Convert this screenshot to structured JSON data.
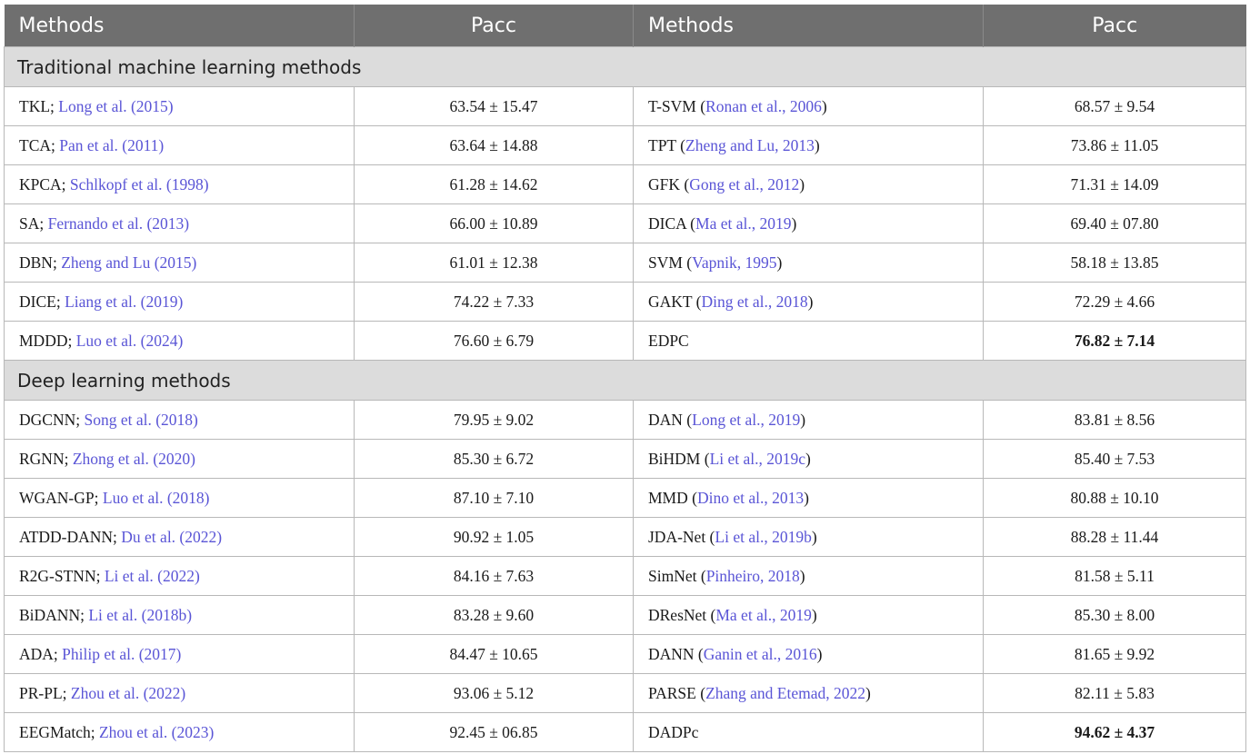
{
  "headers": [
    "Methods",
    "Pacc",
    "Methods",
    "Pacc"
  ],
  "sections": [
    {
      "title": "Traditional machine learning methods",
      "rows": [
        {
          "m1": "TKL; ",
          "r1": "Long et al. (2015)",
          "t1": "",
          "v1": "63.54 ± 15.47",
          "m2": "T-SVM (",
          "r2": "Ronan et al., 2006",
          "t2": ")",
          "v2": "68.57 ± 9.54",
          "b2": false
        },
        {
          "m1": "TCA; ",
          "r1": "Pan et al. (2011)",
          "t1": "",
          "v1": "63.64 ± 14.88",
          "m2": "TPT (",
          "r2": "Zheng and Lu, 2013",
          "t2": ")",
          "v2": "73.86 ± 11.05",
          "b2": false
        },
        {
          "m1": "KPCA; ",
          "r1": "Schlkopf et al. (1998)",
          "t1": "",
          "v1": "61.28 ± 14.62",
          "m2": "GFK (",
          "r2": "Gong et al., 2012",
          "t2": ")",
          "v2": "71.31 ± 14.09",
          "b2": false
        },
        {
          "m1": "SA; ",
          "r1": "Fernando et al. (2013)",
          "t1": "",
          "v1": "66.00 ± 10.89",
          "m2": "DICA (",
          "r2": "Ma et al., 2019",
          "t2": ")",
          "v2": "69.40 ± 07.80",
          "b2": false
        },
        {
          "m1": "DBN; ",
          "r1": "Zheng and Lu (2015)",
          "t1": "",
          "v1": "61.01 ± 12.38",
          "m2": "SVM (",
          "r2": "Vapnik, 1995",
          "t2": ")",
          "v2": "58.18 ± 13.85",
          "b2": false
        },
        {
          "m1": "DICE; ",
          "r1": "Liang et al. (2019)",
          "t1": "",
          "v1": "74.22 ± 7.33",
          "m2": "GAKT (",
          "r2": "Ding et al., 2018",
          "t2": ")",
          "v2": "72.29 ± 4.66",
          "b2": false
        },
        {
          "m1": "MDDD; ",
          "r1": "Luo et al. (2024)",
          "t1": "",
          "v1": "76.60 ± 6.79",
          "m2": "EDPC",
          "r2": "",
          "t2": "",
          "v2": "76.82 ± 7.14",
          "b2": true
        }
      ]
    },
    {
      "title": "Deep learning methods",
      "rows": [
        {
          "m1": "DGCNN; ",
          "r1": "Song et al. (2018)",
          "t1": "",
          "v1": "79.95 ± 9.02",
          "m2": "DAN (",
          "r2": "Long et al., 2019",
          "t2": ")",
          "v2": "83.81 ± 8.56",
          "b2": false
        },
        {
          "m1": "RGNN; ",
          "r1": "Zhong et al. (2020)",
          "t1": "",
          "v1": "85.30 ± 6.72",
          "m2": "BiHDM (",
          "r2": "Li et al., 2019c",
          "t2": ")",
          "v2": "85.40 ± 7.53",
          "b2": false
        },
        {
          "m1": "WGAN-GP; ",
          "r1": "Luo et al. (2018)",
          "t1": "",
          "v1": "87.10 ± 7.10",
          "m2": "MMD (",
          "r2": "Dino et al., 2013",
          "t2": ")",
          "v2": "80.88 ± 10.10",
          "b2": false
        },
        {
          "m1": "ATDD-DANN; ",
          "r1": "Du et al. (2022)",
          "t1": "",
          "v1": "90.92 ± 1.05",
          "m2": "JDA-Net (",
          "r2": "Li et al., 2019b",
          "t2": ")",
          "v2": "88.28 ± 11.44",
          "b2": false
        },
        {
          "m1": "R2G-STNN; ",
          "r1": "Li et al. (2022)",
          "t1": "",
          "v1": "84.16 ± 7.63",
          "m2": "SimNet (",
          "r2": "Pinheiro, 2018",
          "t2": ")",
          "v2": "81.58 ± 5.11",
          "b2": false
        },
        {
          "m1": "BiDANN; ",
          "r1": "Li et al. (2018b)",
          "t1": "",
          "v1": "83.28 ± 9.60",
          "m2": "DResNet (",
          "r2": "Ma et al., 2019",
          "t2": ")",
          "v2": "85.30 ± 8.00",
          "b2": false
        },
        {
          "m1": "ADA; ",
          "r1": "Philip et al. (2017)",
          "t1": "",
          "v1": "84.47 ± 10.65",
          "m2": "DANN (",
          "r2": "Ganin et al., 2016",
          "t2": ")",
          "v2": "81.65 ± 9.92",
          "b2": false
        },
        {
          "m1": "PR-PL; ",
          "r1": "Zhou et al. (2022)",
          "t1": "",
          "v1": "93.06 ± 5.12",
          "m2": "PARSE (",
          "r2": "Zhang and Etemad, 2022",
          "t2": ")",
          "v2": "82.11 ± 5.83",
          "b2": false
        },
        {
          "m1": "EEGMatch; ",
          "r1": "Zhou et al. (2023)",
          "t1": "",
          "v1": "92.45 ± 06.85",
          "m2": "DADPc",
          "r2": "",
          "t2": "",
          "v2": "94.62 ± 4.37",
          "b2": true
        }
      ]
    }
  ],
  "colors": {
    "header_bg": "#6f6f6f",
    "section_bg": "#dcdcdc",
    "link": "#5a55d6"
  }
}
